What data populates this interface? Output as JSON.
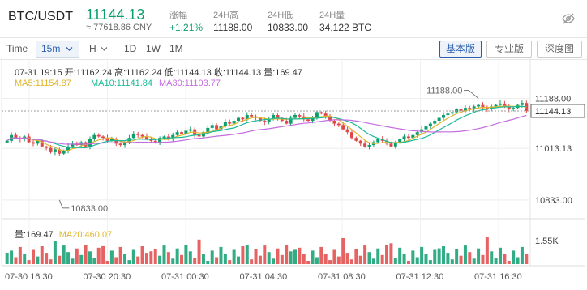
{
  "header": {
    "pair": "BTC/USDT",
    "last_price": "11144.13",
    "cny_price": "≈ 77618.86 CNY",
    "stats": [
      {
        "label": "涨幅",
        "value": "+1.21%",
        "positive": true
      },
      {
        "label": "24H高",
        "value": "11188.00"
      },
      {
        "label": "24H低",
        "value": "10833.00"
      },
      {
        "label": "24H量",
        "value": "34,122 BTC"
      }
    ],
    "icon": "eye-off-icon"
  },
  "toolbar": {
    "time_label": "Time",
    "interval": "15m",
    "items": [
      "H",
      "1D",
      "1W",
      "1M"
    ],
    "view_buttons": [
      {
        "label": "基本版",
        "active": true
      },
      {
        "label": "专业版",
        "active": false
      },
      {
        "label": "深度图",
        "active": false
      }
    ]
  },
  "legend": {
    "ohlc": "07-31 19:15  开:11162.24  高:11162.24  低:11144.13  收:11144.13  量:169.47",
    "ma5": "MA5:11154.87",
    "ma10": "MA10:11141.84",
    "ma30": "MA30:11103.77",
    "volume": "量:169.47",
    "ma20_volume": "MA20:460.07"
  },
  "colors": {
    "up": "#0e9e6e",
    "down": "#e04848",
    "ma5": "#e0b62c",
    "ma10": "#1ab99a",
    "ma30": "#c46ce0",
    "accent": "#2b5fae"
  },
  "chart_data": {
    "type": "candlestick",
    "y_ticks": [
      "11188.00",
      "11013.13",
      "10833.00"
    ],
    "current_price_tag": "11144.13",
    "high_marker": "11188.00",
    "low_marker": "10833.00",
    "volume_tick": "1.55K",
    "x_ticks": [
      "07-30 16:30",
      "07-30 20:30",
      "07-31 00:30",
      "07-31 04:30",
      "07-31 08:30",
      "07-31 12:30",
      "07-31 16:30"
    ],
    "ylim": [
      10790,
      11215
    ],
    "close_series": [
      11040,
      11060,
      11050,
      11045,
      11055,
      11035,
      11030,
      11040,
      11020,
      11015,
      11000,
      11010,
      10995,
      11005,
      11020,
      11030,
      11025,
      11035,
      11020,
      11045,
      11060,
      11055,
      11050,
      11040,
      11045,
      11030,
      11025,
      11035,
      11050,
      11065,
      11060,
      11055,
      11045,
      11040,
      11035,
      11050,
      11055,
      11045,
      11060,
      11070,
      11065,
      11075,
      11080,
      11060,
      11055,
      11070,
      11085,
      11095,
      11080,
      11090,
      11105,
      11100,
      11110,
      11120,
      11115,
      11130,
      11125,
      11120,
      11110,
      11105,
      11115,
      11130,
      11120,
      11110,
      11100,
      11120,
      11130,
      11125,
      11115,
      11110,
      11120,
      11140,
      11135,
      11125,
      11110,
      11100,
      11095,
      11080,
      11070,
      11050,
      11040,
      11030,
      11020,
      11025,
      11035,
      11045,
      11040,
      11030,
      11020,
      11035,
      11045,
      11055,
      11050,
      11060,
      11070,
      11080,
      11090,
      11100,
      11110,
      11120,
      11130,
      11135,
      11140,
      11150,
      11145,
      11155,
      11150,
      11160,
      11165,
      11155,
      11150,
      11160,
      11165,
      11170,
      11160,
      11150,
      11155,
      11165,
      11172,
      11144
    ]
  }
}
